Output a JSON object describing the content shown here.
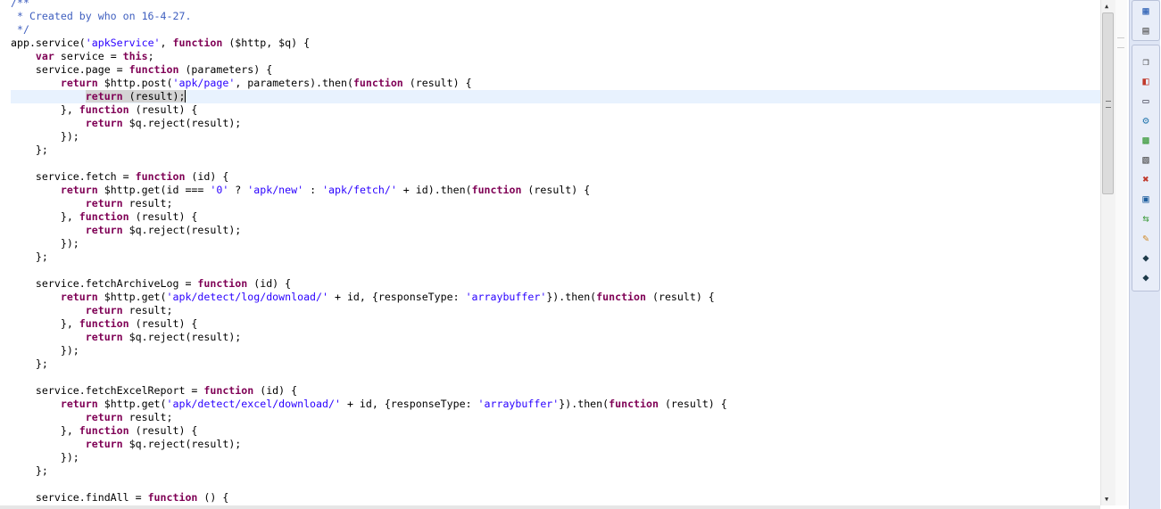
{
  "editor": {
    "current_line": 7,
    "lines": [
      "/**",
      " * Created by who on 16-4-27.",
      " */",
      "app.service('apkService', function ($http, $q) {",
      "    var service = this;",
      "    service.page = function (parameters) {",
      "        return $http.post('apk/page', parameters).then(function (result) {",
      "            return (result);",
      "        }, function (result) {",
      "            return $q.reject(result);",
      "        });",
      "    };",
      "",
      "    service.fetch = function (id) {",
      "        return $http.get(id === '0' ? 'apk/new' : 'apk/fetch/' + id).then(function (result) {",
      "            return result;",
      "        }, function (result) {",
      "            return $q.reject(result);",
      "        });",
      "    };",
      "",
      "    service.fetchArchiveLog = function (id) {",
      "        return $http.get('apk/detect/log/download/' + id, {responseType: 'arraybuffer'}).then(function (result) {",
      "            return result;",
      "        }, function (result) {",
      "            return $q.reject(result);",
      "        });",
      "    };",
      "",
      "    service.fetchExcelReport = function (id) {",
      "        return $http.get('apk/detect/excel/download/' + id, {responseType: 'arraybuffer'}).then(function (result) {",
      "            return result;",
      "        }, function (result) {",
      "            return $q.reject(result);",
      "        });",
      "    };",
      "",
      "    service.findAll = function () {"
    ],
    "colors": {
      "keyword": "#7f0055",
      "string": "#2a00ff",
      "comment": "#3f5fbf",
      "current_line": "#e8f2fe"
    }
  },
  "toolbar": {
    "group1": [
      "outline-icon",
      "task-list-icon"
    ],
    "group2": [
      "restore-icon",
      "data-source-explorer-icon",
      "properties-icon",
      "debug-icon",
      "map-icon",
      "snippets-icon",
      "error-log-icon",
      "console-icon",
      "servers-icon",
      "ant-icon",
      "gradle-tasks-icon",
      "gradle-executions-icon"
    ]
  }
}
